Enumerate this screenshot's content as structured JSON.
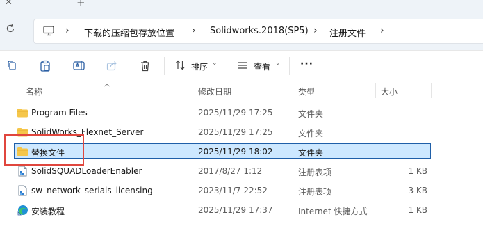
{
  "tabs": {
    "close_glyph": "✕",
    "add_glyph": "+"
  },
  "address": {
    "breadcrumbs": [
      "下载的压缩包存放位置",
      "Solidworks.2018(SP5)",
      "注册文件"
    ],
    "separator": "›"
  },
  "toolbar": {
    "sort_label": "排序",
    "view_label": "查看",
    "more_label": "···",
    "caret": "⌄"
  },
  "columns": {
    "name": "名称",
    "date": "修改日期",
    "type": "类型",
    "size": "大小"
  },
  "files": [
    {
      "name": "Program Files",
      "date": "2025/11/29 17:25",
      "type": "文件夹",
      "size": "",
      "icon": "folder-icon"
    },
    {
      "name": "SolidWorks_Flexnet_Server",
      "date": "2025/11/29 17:25",
      "type": "文件夹",
      "size": "",
      "icon": "folder-icon"
    },
    {
      "name": "替换文件",
      "date": "2025/11/29 18:02",
      "type": "文件夹",
      "size": "",
      "icon": "folder-icon",
      "selected": true
    },
    {
      "name": "SolidSQUADLoaderEnabler",
      "date": "2017/8/27 1:12",
      "type": "注册表项",
      "size": "1 KB",
      "icon": "registry-file-icon"
    },
    {
      "name": "sw_network_serials_licensing",
      "date": "2023/11/7 22:52",
      "type": "注册表项",
      "size": "3 KB",
      "icon": "registry-file-icon"
    },
    {
      "name": "安装教程",
      "date": "2025/11/29 17:37",
      "type": "Internet 快捷方式",
      "size": "1 KB",
      "icon": "edge-shortcut-icon"
    }
  ],
  "colors": {
    "selection_fill": "#cde8ff",
    "selection_border": "#1f5fa8",
    "annotation_red": "#e0463d",
    "folder_yellow": "#f5c64a"
  }
}
